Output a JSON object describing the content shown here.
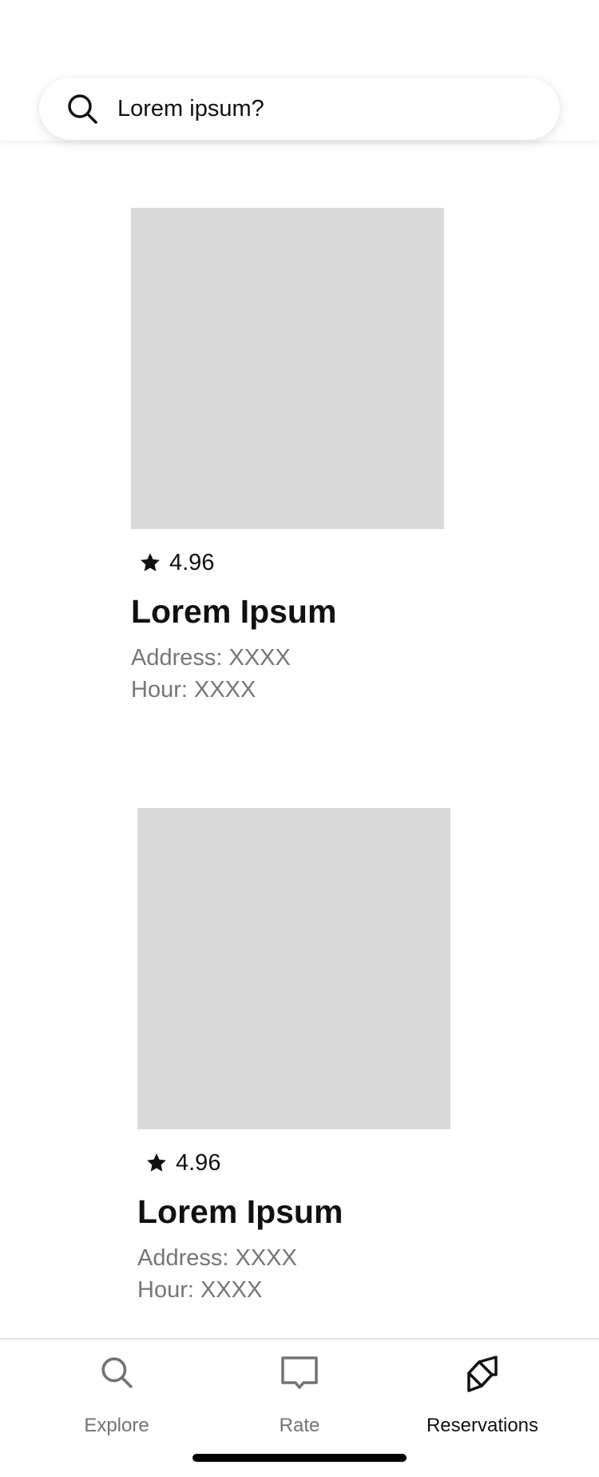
{
  "search": {
    "placeholder": "Lorem ipsum?",
    "icon": "search-icon"
  },
  "listings": [
    {
      "rating": "4.96",
      "title": "Lorem Ipsum",
      "address": "Address: XXXX",
      "hour": "Hour: XXXX"
    },
    {
      "rating": "4.96",
      "title": "Lorem Ipsum",
      "address": "Address: XXXX",
      "hour": "Hour: XXXX"
    }
  ],
  "tabs": [
    {
      "label": "Explore",
      "icon": "search-icon",
      "active": false
    },
    {
      "label": "Rate",
      "icon": "chat-bubble-icon",
      "active": false
    },
    {
      "label": "Reservations",
      "icon": "cube-icon",
      "active": true
    }
  ],
  "colors": {
    "image_placeholder": "#d9d9d9",
    "inactive_tab": "#737373",
    "active_tab": "#111111",
    "meta_text": "#767676"
  }
}
